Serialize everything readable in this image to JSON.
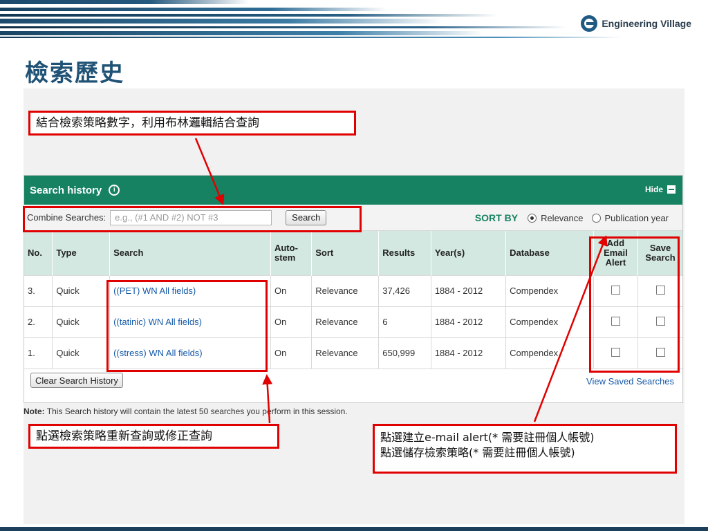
{
  "slide": {
    "title": "檢索歷史",
    "logo_text": "Engineering Village"
  },
  "callouts": {
    "top": "結合檢索策略數字，利用布林邏輯結合查詢",
    "bottom_left": "點選檢索策略重新查詢或修正查詢",
    "bottom_right_line1": "點選建立e-mail alert(* 需要註冊個人帳號)",
    "bottom_right_line2": "點選儲存檢索策略(* 需要註冊個人帳號)"
  },
  "panel": {
    "title": "Search history",
    "info_glyph": "i",
    "hide_label": "Hide",
    "combine_label": "Combine Searches:",
    "combine_placeholder": "e.g., (#1 AND #2) NOT #3",
    "search_button": "Search",
    "sort_by_label": "SORT BY",
    "sort_options": [
      {
        "label": "Relevance",
        "selected": true
      },
      {
        "label": "Publication year",
        "selected": false
      }
    ],
    "columns": {
      "no": "No.",
      "type": "Type",
      "search": "Search",
      "autostem": "Auto-\nstem",
      "sort": "Sort",
      "results": "Results",
      "years": "Year(s)",
      "database": "Database",
      "alert": "Add\nEmail\nAlert",
      "save": "Save\nSearch"
    },
    "rows": [
      {
        "no": "3.",
        "type": "Quick",
        "search": "((PET) WN All fields)",
        "autostem": "On",
        "sort": "Relevance",
        "results": "37,426",
        "years": "1884 - 2012",
        "database": "Compendex"
      },
      {
        "no": "2.",
        "type": "Quick",
        "search": "((tatinic) WN All fields)",
        "autostem": "On",
        "sort": "Relevance",
        "results": "6",
        "years": "1884 - 2012",
        "database": "Compendex"
      },
      {
        "no": "1.",
        "type": "Quick",
        "search": "((stress) WN All fields)",
        "autostem": "On",
        "sort": "Relevance",
        "results": "650,999",
        "years": "1884 - 2012",
        "database": "Compendex"
      }
    ],
    "clear_button": "Clear Search History",
    "view_saved_link": "View Saved Searches"
  },
  "note": {
    "label": "Note:",
    "text": "This Search history will contain the latest 50 searches you perform in this session."
  },
  "colors": {
    "header_green": "#168262",
    "table_header": "#d3e8e1",
    "highlight_red": "#e00000",
    "link_blue": "#1559a8",
    "title_blue": "#1f5275"
  },
  "icons": [
    "info-icon",
    "hide-collapse-icon",
    "radio-icon",
    "checkbox-icon",
    "engineering-village-logo-icon"
  ]
}
